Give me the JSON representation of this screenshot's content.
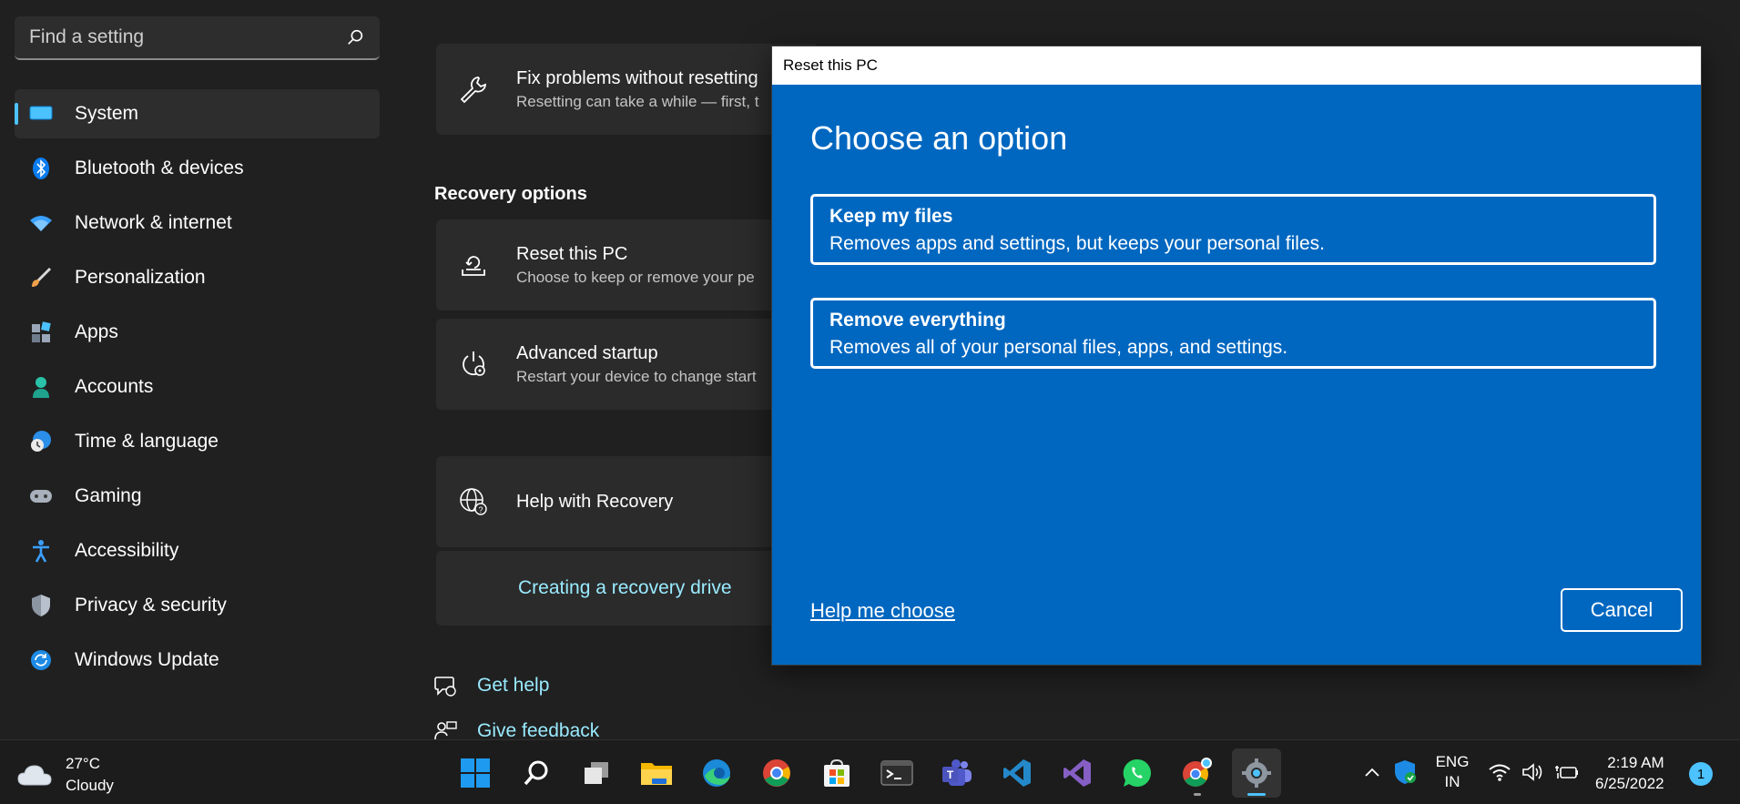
{
  "search": {
    "placeholder": "Find a setting"
  },
  "sidebar": {
    "items": [
      {
        "label": "System",
        "icon": "monitor-icon",
        "active": true
      },
      {
        "label": "Bluetooth & devices",
        "icon": "bluetooth-icon"
      },
      {
        "label": "Network & internet",
        "icon": "wifi-icon"
      },
      {
        "label": "Personalization",
        "icon": "brush-icon"
      },
      {
        "label": "Apps",
        "icon": "apps-icon"
      },
      {
        "label": "Accounts",
        "icon": "person-icon"
      },
      {
        "label": "Time & language",
        "icon": "globe-clock-icon"
      },
      {
        "label": "Gaming",
        "icon": "gamepad-icon"
      },
      {
        "label": "Accessibility",
        "icon": "accessibility-icon"
      },
      {
        "label": "Privacy & security",
        "icon": "shield-icon"
      },
      {
        "label": "Windows Update",
        "icon": "update-icon"
      }
    ]
  },
  "main": {
    "fix_card": {
      "title": "Fix problems without resetting",
      "subtitle": "Resetting can take a while — first, t"
    },
    "recovery_title": "Recovery options",
    "reset_card": {
      "title": "Reset this PC",
      "subtitle": "Choose to keep or remove your pe"
    },
    "advanced_card": {
      "title": "Advanced startup",
      "subtitle": "Restart your device to change start"
    },
    "help_card": {
      "title": "Help with Recovery",
      "link": "Creating a recovery drive"
    },
    "get_help": "Get help",
    "give_feedback": "Give feedback"
  },
  "dialog": {
    "window_title": "Reset this PC",
    "heading": "Choose an option",
    "options": [
      {
        "title": "Keep my files",
        "description": "Removes apps and settings, but keeps your personal files."
      },
      {
        "title": "Remove everything",
        "description": "Removes all of your personal files, apps, and settings."
      }
    ],
    "help_link": "Help me choose",
    "cancel_label": "Cancel"
  },
  "taskbar": {
    "weather": {
      "temp": "27°C",
      "condition": "Cloudy"
    },
    "apps": [
      "start-icon",
      "search-icon",
      "task-view-icon",
      "file-explorer-icon",
      "edge-icon",
      "chrome-icon",
      "store-icon",
      "terminal-icon",
      "teams-icon",
      "vscode-icon",
      "visual-studio-icon",
      "whatsapp-icon",
      "chrome-canary-icon",
      "settings-icon"
    ],
    "language": {
      "line1": "ENG",
      "line2": "IN"
    },
    "clock": {
      "time": "2:19 AM",
      "date": "6/25/2022"
    },
    "notification_count": "1"
  },
  "colors": {
    "accent": "#4cc2ff",
    "dialog_blue": "#0067c0",
    "link": "#99ebff"
  }
}
